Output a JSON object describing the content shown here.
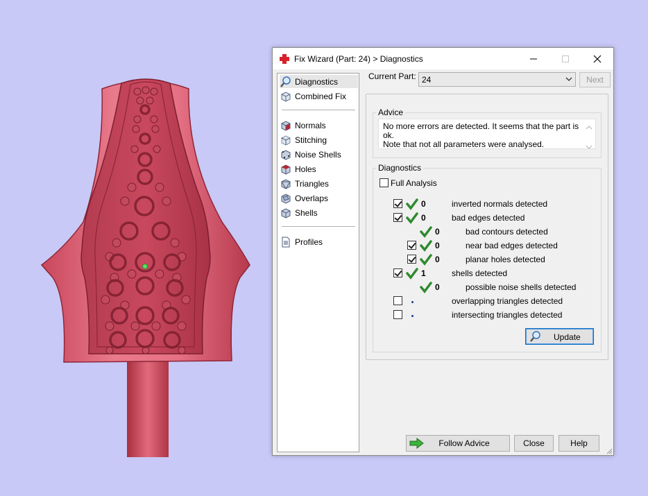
{
  "window": {
    "title": "Fix Wizard (Part: 24) > Diagnostics",
    "icons": [
      "red-cross-icon",
      "minimize-icon",
      "maximize-icon",
      "close-icon"
    ]
  },
  "nav": {
    "items": [
      {
        "label": "Diagnostics",
        "icon": "magnifier-icon",
        "selected": true
      },
      {
        "label": "Combined Fix",
        "icon": "cube-icon"
      },
      {
        "label": "Normals",
        "icon": "cube-icon"
      },
      {
        "label": "Stitching",
        "icon": "cube-icon"
      },
      {
        "label": "Noise Shells",
        "icon": "cube-icon"
      },
      {
        "label": "Holes",
        "icon": "cube-icon"
      },
      {
        "label": "Triangles",
        "icon": "cube-icon"
      },
      {
        "label": "Overlaps",
        "icon": "cube-icon"
      },
      {
        "label": "Shells",
        "icon": "cube-icon"
      },
      {
        "label": "Profiles",
        "icon": "document-icon"
      }
    ]
  },
  "header": {
    "current_part_label": "Current Part:",
    "current_part_value": "24",
    "next_label": "Next"
  },
  "advice": {
    "title": "Advice",
    "line1": "No more errors are detected. It seems that the part is ok.",
    "line2": "Note that not all parameters were analysed."
  },
  "diagnostics": {
    "title": "Diagnostics",
    "full_analysis_label": "Full Analysis",
    "full_analysis_checked": false,
    "rows": [
      {
        "checkbox": true,
        "checked": true,
        "status": "ok",
        "count": "0",
        "label": "inverted normals detected"
      },
      {
        "checkbox": true,
        "checked": true,
        "status": "ok",
        "count": "0",
        "label": "bad edges detected"
      },
      {
        "checkbox": false,
        "status": "ok",
        "count": "0",
        "label": "bad contours detected"
      },
      {
        "checkbox": true,
        "checked": true,
        "status": "ok",
        "count": "0",
        "label": "near bad edges detected"
      },
      {
        "checkbox": true,
        "checked": true,
        "status": "ok",
        "count": "0",
        "label": "planar holes detected"
      },
      {
        "checkbox": true,
        "checked": true,
        "status": "ok",
        "count": "1",
        "label": "shells detected"
      },
      {
        "checkbox": false,
        "status": "ok",
        "count": "0",
        "label": "possible noise shells detected"
      },
      {
        "checkbox": true,
        "checked": false,
        "status": "none",
        "count": "",
        "label": "overlapping triangles detected"
      },
      {
        "checkbox": true,
        "checked": false,
        "status": "none",
        "count": "",
        "label": "intersecting triangles detected"
      }
    ],
    "update_label": "Update"
  },
  "footer": {
    "follow_advice_label": "Follow Advice",
    "close_label": "Close",
    "help_label": "Help"
  },
  "colors": {
    "background": "#c8c9f6",
    "model": "#c9485e",
    "check_green": "#2f8a2f",
    "accent": "#0f6fc6"
  }
}
